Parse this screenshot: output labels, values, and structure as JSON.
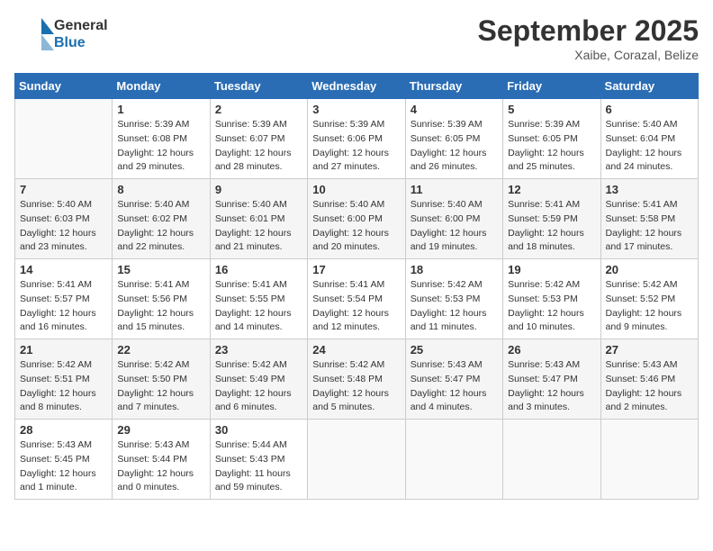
{
  "header": {
    "title": "September 2025",
    "location": "Xaibe, Corazal, Belize"
  },
  "logo": {
    "line1": "General",
    "line2": "Blue"
  },
  "days_of_week": [
    "Sunday",
    "Monday",
    "Tuesday",
    "Wednesday",
    "Thursday",
    "Friday",
    "Saturday"
  ],
  "weeks": [
    [
      {
        "day": "",
        "info": ""
      },
      {
        "day": "1",
        "info": "Sunrise: 5:39 AM\nSunset: 6:08 PM\nDaylight: 12 hours\nand 29 minutes."
      },
      {
        "day": "2",
        "info": "Sunrise: 5:39 AM\nSunset: 6:07 PM\nDaylight: 12 hours\nand 28 minutes."
      },
      {
        "day": "3",
        "info": "Sunrise: 5:39 AM\nSunset: 6:06 PM\nDaylight: 12 hours\nand 27 minutes."
      },
      {
        "day": "4",
        "info": "Sunrise: 5:39 AM\nSunset: 6:05 PM\nDaylight: 12 hours\nand 26 minutes."
      },
      {
        "day": "5",
        "info": "Sunrise: 5:39 AM\nSunset: 6:05 PM\nDaylight: 12 hours\nand 25 minutes."
      },
      {
        "day": "6",
        "info": "Sunrise: 5:40 AM\nSunset: 6:04 PM\nDaylight: 12 hours\nand 24 minutes."
      }
    ],
    [
      {
        "day": "7",
        "info": "Sunrise: 5:40 AM\nSunset: 6:03 PM\nDaylight: 12 hours\nand 23 minutes."
      },
      {
        "day": "8",
        "info": "Sunrise: 5:40 AM\nSunset: 6:02 PM\nDaylight: 12 hours\nand 22 minutes."
      },
      {
        "day": "9",
        "info": "Sunrise: 5:40 AM\nSunset: 6:01 PM\nDaylight: 12 hours\nand 21 minutes."
      },
      {
        "day": "10",
        "info": "Sunrise: 5:40 AM\nSunset: 6:00 PM\nDaylight: 12 hours\nand 20 minutes."
      },
      {
        "day": "11",
        "info": "Sunrise: 5:40 AM\nSunset: 6:00 PM\nDaylight: 12 hours\nand 19 minutes."
      },
      {
        "day": "12",
        "info": "Sunrise: 5:41 AM\nSunset: 5:59 PM\nDaylight: 12 hours\nand 18 minutes."
      },
      {
        "day": "13",
        "info": "Sunrise: 5:41 AM\nSunset: 5:58 PM\nDaylight: 12 hours\nand 17 minutes."
      }
    ],
    [
      {
        "day": "14",
        "info": "Sunrise: 5:41 AM\nSunset: 5:57 PM\nDaylight: 12 hours\nand 16 minutes."
      },
      {
        "day": "15",
        "info": "Sunrise: 5:41 AM\nSunset: 5:56 PM\nDaylight: 12 hours\nand 15 minutes."
      },
      {
        "day": "16",
        "info": "Sunrise: 5:41 AM\nSunset: 5:55 PM\nDaylight: 12 hours\nand 14 minutes."
      },
      {
        "day": "17",
        "info": "Sunrise: 5:41 AM\nSunset: 5:54 PM\nDaylight: 12 hours\nand 12 minutes."
      },
      {
        "day": "18",
        "info": "Sunrise: 5:42 AM\nSunset: 5:53 PM\nDaylight: 12 hours\nand 11 minutes."
      },
      {
        "day": "19",
        "info": "Sunrise: 5:42 AM\nSunset: 5:53 PM\nDaylight: 12 hours\nand 10 minutes."
      },
      {
        "day": "20",
        "info": "Sunrise: 5:42 AM\nSunset: 5:52 PM\nDaylight: 12 hours\nand 9 minutes."
      }
    ],
    [
      {
        "day": "21",
        "info": "Sunrise: 5:42 AM\nSunset: 5:51 PM\nDaylight: 12 hours\nand 8 minutes."
      },
      {
        "day": "22",
        "info": "Sunrise: 5:42 AM\nSunset: 5:50 PM\nDaylight: 12 hours\nand 7 minutes."
      },
      {
        "day": "23",
        "info": "Sunrise: 5:42 AM\nSunset: 5:49 PM\nDaylight: 12 hours\nand 6 minutes."
      },
      {
        "day": "24",
        "info": "Sunrise: 5:42 AM\nSunset: 5:48 PM\nDaylight: 12 hours\nand 5 minutes."
      },
      {
        "day": "25",
        "info": "Sunrise: 5:43 AM\nSunset: 5:47 PM\nDaylight: 12 hours\nand 4 minutes."
      },
      {
        "day": "26",
        "info": "Sunrise: 5:43 AM\nSunset: 5:47 PM\nDaylight: 12 hours\nand 3 minutes."
      },
      {
        "day": "27",
        "info": "Sunrise: 5:43 AM\nSunset: 5:46 PM\nDaylight: 12 hours\nand 2 minutes."
      }
    ],
    [
      {
        "day": "28",
        "info": "Sunrise: 5:43 AM\nSunset: 5:45 PM\nDaylight: 12 hours\nand 1 minute."
      },
      {
        "day": "29",
        "info": "Sunrise: 5:43 AM\nSunset: 5:44 PM\nDaylight: 12 hours\nand 0 minutes."
      },
      {
        "day": "30",
        "info": "Sunrise: 5:44 AM\nSunset: 5:43 PM\nDaylight: 11 hours\nand 59 minutes."
      },
      {
        "day": "",
        "info": ""
      },
      {
        "day": "",
        "info": ""
      },
      {
        "day": "",
        "info": ""
      },
      {
        "day": "",
        "info": ""
      }
    ]
  ]
}
